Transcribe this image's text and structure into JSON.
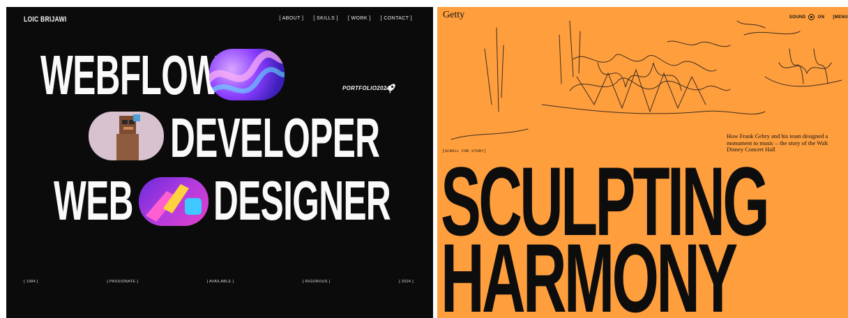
{
  "left": {
    "logo": "LOIC BRIJAWI",
    "nav": [
      "[ ABOUT ]",
      "[ SKILLS ]",
      "[ WORK ]",
      "[ CONTACT ]"
    ],
    "lines": [
      "WEBFLOW",
      "DEVELOPER",
      "WEB",
      "DESIGNER"
    ],
    "portfolio": "PORTFOLIO2024",
    "footer": [
      "[ 1984 ]",
      "[ PASSIONATE ]",
      "[ AVAILABLE ]",
      "[ RIGOROUS ]",
      "[ 2024 ]"
    ],
    "colors": {
      "bg": "#0b0b0b",
      "text": "#f2f2f2",
      "accent_purple": "#7b3dff",
      "accent_pink": "#e040c8"
    }
  },
  "right": {
    "logo": "Getty",
    "sound_label": "SOUND",
    "sound_state": "ON",
    "menu_label": "[MENU",
    "description": "How Frank Gehry and his team designed a monument to music – the story of the Walt Disney Concert Hall",
    "scroll_label": "[SCROLL FOR STORY]",
    "headline": [
      "SCULPTING",
      "HARMONY"
    ],
    "colors": {
      "bg": "#ff9e3d",
      "text": "#0d0d0d"
    }
  }
}
